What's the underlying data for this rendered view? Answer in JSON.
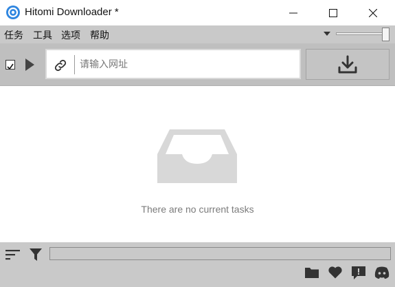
{
  "window": {
    "title": "Hitomi Downloader *",
    "controls": [
      "minimize-icon",
      "maximize-icon",
      "close-icon"
    ]
  },
  "menu": {
    "items": [
      "任务",
      "工具",
      "选项",
      "帮助"
    ],
    "zoom_slider_level": 1.0
  },
  "toolbar": {
    "checkbox_checked": true,
    "url_placeholder": "请输入网址",
    "url_value": "",
    "icons": [
      "play-icon",
      "link-icon",
      "download-icon"
    ]
  },
  "main": {
    "empty_message": "There are no current tasks",
    "empty_icon": "inbox-tray-icon"
  },
  "status": {
    "progress": 0,
    "icons": [
      "sort-icon",
      "filter-icon",
      "folder-icon",
      "heart-icon",
      "feedback-icon",
      "discord-icon"
    ]
  },
  "colors": {
    "accent": "#2f86e0",
    "menubar_bg": "#c9c9c9",
    "toolbar_bg": "#bfbfbf",
    "empty_icon": "#d8d8d8",
    "empty_text": "#7b7b7b"
  }
}
